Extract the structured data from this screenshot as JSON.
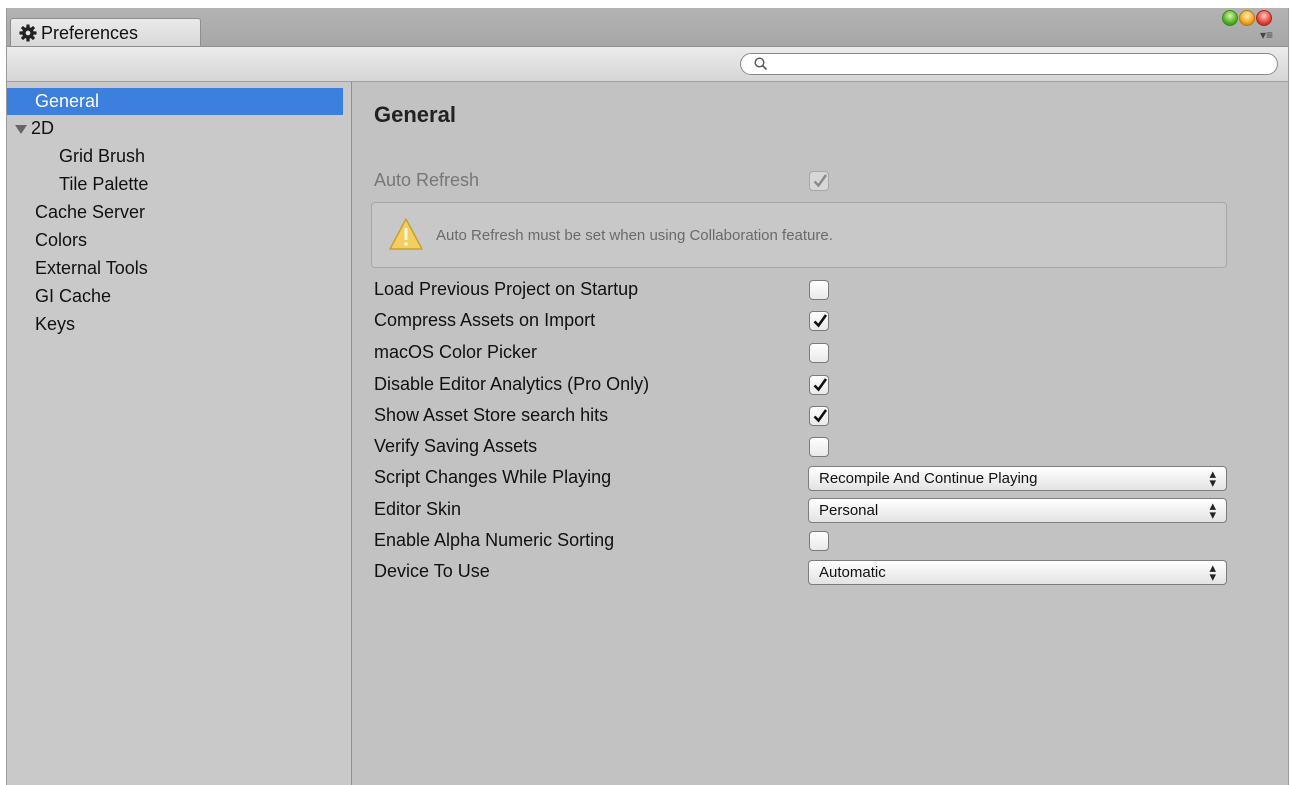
{
  "window": {
    "tab_title": "Preferences",
    "icons": {
      "tab": "gear-icon",
      "menu": "menu-icon",
      "search": "search-icon"
    },
    "search": {
      "placeholder": ""
    }
  },
  "sidebar": {
    "items": [
      {
        "label": "General",
        "selected": true
      },
      {
        "label": "2D",
        "expanded": true
      },
      {
        "label": "Grid Brush"
      },
      {
        "label": "Tile Palette"
      },
      {
        "label": "Cache Server"
      },
      {
        "label": "Colors"
      },
      {
        "label": "External Tools"
      },
      {
        "label": "GI Cache"
      },
      {
        "label": "Keys"
      }
    ]
  },
  "main": {
    "title": "General",
    "auto_refresh": {
      "label": "Auto Refresh",
      "checked": true,
      "disabled": true
    },
    "help_box": {
      "message": "Auto Refresh must be set when using Collaboration feature.",
      "icon": "warning-icon"
    },
    "settings": [
      {
        "label": "Load Previous Project on Startup",
        "checked": false
      },
      {
        "label": "Compress Assets on Import",
        "checked": true
      },
      {
        "label": "macOS Color Picker",
        "checked": false
      },
      {
        "label": "Disable Editor Analytics (Pro Only)",
        "checked": true
      },
      {
        "label": "Show Asset Store search hits",
        "checked": true
      },
      {
        "label": "Verify Saving Assets",
        "checked": false
      },
      {
        "label": "Script Changes While Playing",
        "value": "Recompile And Continue Playing"
      },
      {
        "label": "Editor Skin",
        "value": "Personal"
      },
      {
        "label": "Enable Alpha Numeric Sorting",
        "checked": false
      },
      {
        "label": "Device To Use",
        "value": "Automatic"
      }
    ]
  },
  "colors": {
    "selection": "#3d7fdc",
    "panel": "#c2c2c2"
  }
}
